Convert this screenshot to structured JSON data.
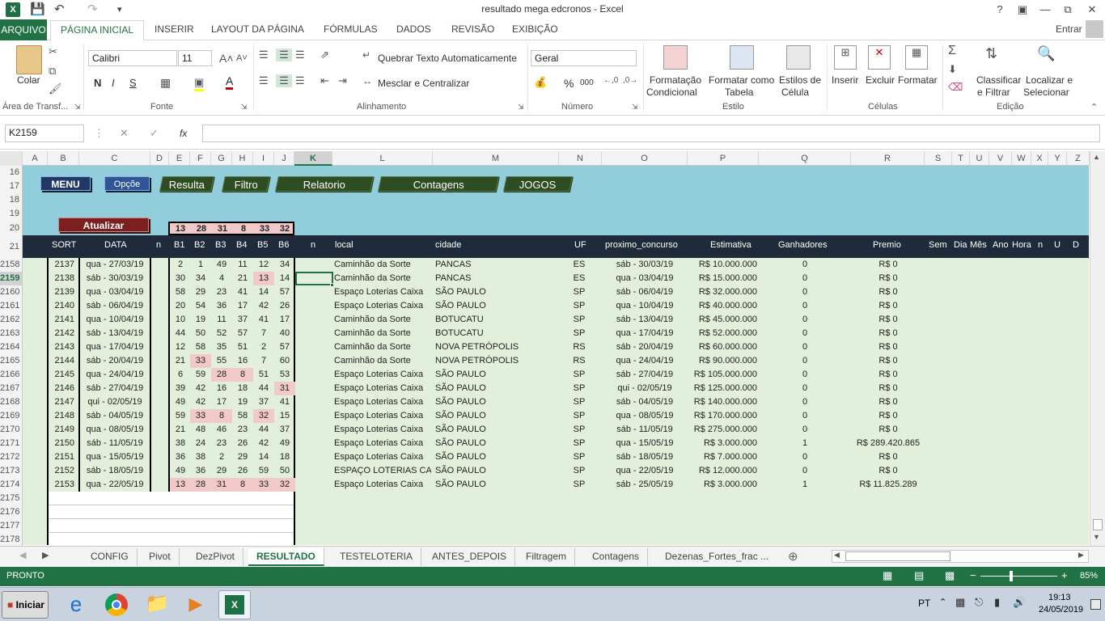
{
  "window": {
    "title": "resultado mega edcronos - Excel",
    "help": "?",
    "user": "Entrar"
  },
  "menu": {
    "file": "ARQUIVO",
    "tabs": [
      "PÁGINA INICIAL",
      "INSERIR",
      "LAYOUT DA PÁGINA",
      "FÓRMULAS",
      "DADOS",
      "REVISÃO",
      "EXIBIÇÃO"
    ]
  },
  "ribbon": {
    "paste": "Colar",
    "clipboard_label": "Área de Transf...",
    "font_name": "Calibri",
    "font_size": "11",
    "bold": "N",
    "italic": "I",
    "underline": "S",
    "font_label": "Fonte",
    "wrap_text": "Quebrar Texto Automaticamente",
    "merge_center": "Mesclar e Centralizar",
    "alignment_label": "Alinhamento",
    "number_format": "Geral",
    "percent": "%",
    "thousands": "000",
    "number_label": "Número",
    "cond_format": [
      "Formatação",
      "Condicional"
    ],
    "format_table": [
      "Formatar como",
      "Tabela"
    ],
    "cell_styles": [
      "Estilos de",
      "Célula"
    ],
    "styles_label": "Estilo",
    "insert": "Inserir",
    "delete": "Excluir",
    "format": "Formatar",
    "cells_label": "Células",
    "sort_filter": [
      "Classificar",
      "e Filtrar"
    ],
    "find_select": [
      "Localizar e",
      "Selecionar"
    ],
    "editing_label": "Edição"
  },
  "formula_bar": {
    "name_box": "K2159",
    "fx": "fx",
    "value": ""
  },
  "columns": [
    "A",
    "B",
    "C",
    "D",
    "E",
    "F",
    "G",
    "H",
    "I",
    "J",
    "K",
    "L",
    "M",
    "N",
    "O",
    "P",
    "Q",
    "R",
    "S",
    "T",
    "U",
    "V",
    "W",
    "X",
    "Y",
    "Z"
  ],
  "rows_top": [
    "16",
    "17",
    "18",
    "19",
    "20",
    "21"
  ],
  "buttons": {
    "menu": "MENU",
    "opcoes": "Opçõe",
    "atualizar": "Atualizar"
  },
  "nav": [
    "Resulta",
    "Filtro",
    "Relatorio",
    "Contagens",
    "JOGOS"
  ],
  "current_numbers": [
    "13",
    "28",
    "31",
    "8",
    "33",
    "32"
  ],
  "headers": [
    "SORT",
    "DATA",
    "n",
    "B1",
    "B2",
    "B3",
    "B4",
    "B5",
    "B6",
    "n",
    "local",
    "cidade",
    "UF",
    "proximo_concurso",
    "Estimativa",
    "Ganhadores",
    "Premio",
    "Sem",
    "Dia",
    "Mês",
    "Ano",
    "Hora",
    "n",
    "U",
    "D"
  ],
  "rows": [
    {
      "row": "2158",
      "sort": "2137",
      "data": "qua - 27/03/19",
      "b": [
        "2",
        "1",
        "49",
        "11",
        "12",
        "34"
      ],
      "local": "Caminhão da Sorte",
      "cidade": "PANCAS",
      "uf": "ES",
      "prox": "sáb - 30/03/19",
      "est": "R$ 10.000.000",
      "gan": "0",
      "premio": "R$ 0"
    },
    {
      "row": "2159",
      "sort": "2138",
      "data": "sáb - 30/03/19",
      "b": [
        "30",
        "34",
        "4",
        "21",
        "13",
        "14"
      ],
      "local": "Caminhão da Sorte",
      "cidade": "PANCAS",
      "uf": "ES",
      "prox": "qua - 03/04/19",
      "est": "R$ 15.000.000",
      "gan": "0",
      "premio": "R$ 0"
    },
    {
      "row": "2160",
      "sort": "2139",
      "data": "qua - 03/04/19",
      "b": [
        "58",
        "29",
        "23",
        "41",
        "14",
        "57"
      ],
      "local": "Espaço Loterias Caixa",
      "cidade": "SÃO PAULO",
      "uf": "SP",
      "prox": "sáb - 06/04/19",
      "est": "R$ 32.000.000",
      "gan": "0",
      "premio": "R$ 0"
    },
    {
      "row": "2161",
      "sort": "2140",
      "data": "sáb - 06/04/19",
      "b": [
        "20",
        "54",
        "36",
        "17",
        "42",
        "26"
      ],
      "local": "Espaço Loterias Caixa",
      "cidade": "SÃO PAULO",
      "uf": "SP",
      "prox": "qua - 10/04/19",
      "est": "R$ 40.000.000",
      "gan": "0",
      "premio": "R$ 0"
    },
    {
      "row": "2162",
      "sort": "2141",
      "data": "qua - 10/04/19",
      "b": [
        "10",
        "19",
        "11",
        "37",
        "41",
        "17"
      ],
      "local": "Caminhão da Sorte",
      "cidade": "BOTUCATU",
      "uf": "SP",
      "prox": "sáb - 13/04/19",
      "est": "R$ 45.000.000",
      "gan": "0",
      "premio": "R$ 0"
    },
    {
      "row": "2163",
      "sort": "2142",
      "data": "sáb - 13/04/19",
      "b": [
        "44",
        "50",
        "52",
        "57",
        "7",
        "40"
      ],
      "local": "Caminhão da Sorte",
      "cidade": "BOTUCATU",
      "uf": "SP",
      "prox": "qua - 17/04/19",
      "est": "R$ 52.000.000",
      "gan": "0",
      "premio": "R$ 0"
    },
    {
      "row": "2164",
      "sort": "2143",
      "data": "qua - 17/04/19",
      "b": [
        "12",
        "58",
        "35",
        "51",
        "2",
        "57"
      ],
      "local": "Caminhão da Sorte",
      "cidade": "NOVA PETRÓPOLIS",
      "uf": "RS",
      "prox": "sáb - 20/04/19",
      "est": "R$ 60.000.000",
      "gan": "0",
      "premio": "R$ 0"
    },
    {
      "row": "2165",
      "sort": "2144",
      "data": "sáb - 20/04/19",
      "b": [
        "21",
        "33",
        "55",
        "16",
        "7",
        "60"
      ],
      "local": "Caminhão da Sorte",
      "cidade": "NOVA PETRÓPOLIS",
      "uf": "RS",
      "prox": "qua - 24/04/19",
      "est": "R$ 90.000.000",
      "gan": "0",
      "premio": "R$ 0"
    },
    {
      "row": "2166",
      "sort": "2145",
      "data": "qua - 24/04/19",
      "b": [
        "6",
        "59",
        "28",
        "8",
        "51",
        "53"
      ],
      "local": "Espaço Loterias Caixa",
      "cidade": "SÃO PAULO",
      "uf": "SP",
      "prox": "sáb - 27/04/19",
      "est": "R$ 105.000.000",
      "gan": "0",
      "premio": "R$ 0"
    },
    {
      "row": "2167",
      "sort": "2146",
      "data": "sáb - 27/04/19",
      "b": [
        "39",
        "42",
        "16",
        "18",
        "44",
        "31"
      ],
      "local": "Espaço Loterias Caixa",
      "cidade": "SÃO PAULO",
      "uf": "SP",
      "prox": "qui - 02/05/19",
      "est": "R$ 125.000.000",
      "gan": "0",
      "premio": "R$ 0"
    },
    {
      "row": "2168",
      "sort": "2147",
      "data": "qui - 02/05/19",
      "b": [
        "49",
        "42",
        "17",
        "19",
        "37",
        "41"
      ],
      "local": "Espaço Loterias Caixa",
      "cidade": "SÃO PAULO",
      "uf": "SP",
      "prox": "sáb - 04/05/19",
      "est": "R$ 140.000.000",
      "gan": "0",
      "premio": "R$ 0"
    },
    {
      "row": "2169",
      "sort": "2148",
      "data": "sáb - 04/05/19",
      "b": [
        "59",
        "33",
        "8",
        "58",
        "32",
        "15"
      ],
      "local": "Espaço Loterias Caixa",
      "cidade": "SÃO PAULO",
      "uf": "SP",
      "prox": "qua - 08/05/19",
      "est": "R$ 170.000.000",
      "gan": "0",
      "premio": "R$ 0"
    },
    {
      "row": "2170",
      "sort": "2149",
      "data": "qua - 08/05/19",
      "b": [
        "21",
        "48",
        "46",
        "23",
        "44",
        "37"
      ],
      "local": "Espaço Loterias Caixa",
      "cidade": "SÃO PAULO",
      "uf": "SP",
      "prox": "sáb - 11/05/19",
      "est": "R$ 275.000.000",
      "gan": "0",
      "premio": "R$ 0"
    },
    {
      "row": "2171",
      "sort": "2150",
      "data": "sáb - 11/05/19",
      "b": [
        "38",
        "24",
        "23",
        "26",
        "42",
        "49"
      ],
      "local": "Espaço Loterias Caixa",
      "cidade": "SÃO PAULO",
      "uf": "SP",
      "prox": "qua - 15/05/19",
      "est": "R$ 3.000.000",
      "gan": "1",
      "premio": "R$ 289.420.865"
    },
    {
      "row": "2172",
      "sort": "2151",
      "data": "qua - 15/05/19",
      "b": [
        "36",
        "38",
        "2",
        "29",
        "14",
        "18"
      ],
      "local": "Espaço Loterias Caixa",
      "cidade": "SÃO PAULO",
      "uf": "SP",
      "prox": "sáb - 18/05/19",
      "est": "R$ 7.000.000",
      "gan": "0",
      "premio": "R$ 0"
    },
    {
      "row": "2173",
      "sort": "2152",
      "data": "sáb - 18/05/19",
      "b": [
        "49",
        "36",
        "29",
        "26",
        "59",
        "50"
      ],
      "local": "ESPAÇO LOTERIAS CAIXA",
      "cidade": "SÃO PAULO",
      "uf": "SP",
      "prox": "qua - 22/05/19",
      "est": "R$ 12.000.000",
      "gan": "0",
      "premio": "R$ 0"
    },
    {
      "row": "2174",
      "sort": "2153",
      "data": "qua - 22/05/19",
      "b": [
        "13",
        "28",
        "31",
        "8",
        "33",
        "32"
      ],
      "local": "Espaço Loterias Caixa",
      "cidade": "SÃO PAULO",
      "uf": "SP",
      "prox": "sáb - 25/05/19",
      "est": "R$ 3.000.000",
      "gan": "1",
      "premio": "R$ 11.825.289"
    }
  ],
  "empty_rows": [
    "2175",
    "2176",
    "2177",
    "2178"
  ],
  "sheet_tabs": [
    "CONFIG",
    "Pivot",
    "DezPivot",
    "RESULTADO",
    "TESTELOTERIA",
    "ANTES_DEPOIS",
    "Filtragem",
    "Contagens",
    "Dezenas_Fortes_frac ..."
  ],
  "active_sheet": "RESULTADO",
  "status": {
    "mode": "PRONTO",
    "zoom": "85%"
  },
  "taskbar": {
    "start": "Iniciar",
    "lang": "PT",
    "time": "19:13",
    "date": "24/05/2019"
  },
  "colors": {
    "excel_green": "#217346",
    "band": "#92cddc",
    "header": "#1f2b3a",
    "data_bg": "#e2efda",
    "highlight": "#f2c9c9",
    "nav_button": "#2e4d23",
    "menu_button": "#1f3864",
    "atualizar_button": "#7b1f1f"
  }
}
